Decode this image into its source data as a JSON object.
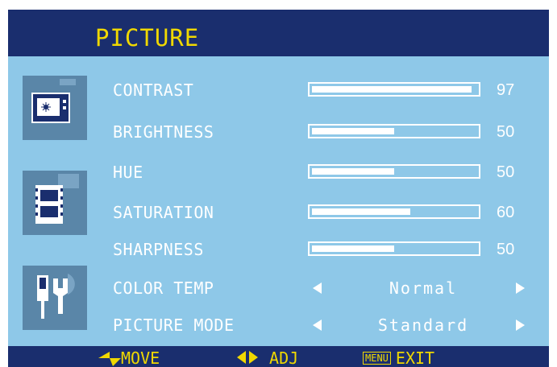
{
  "header": {
    "title": "PICTURE"
  },
  "icons": [
    "picture-icon",
    "film-icon",
    "tools-icon"
  ],
  "sliders": [
    {
      "name": "contrast",
      "label": "CONTRAST",
      "value": 97
    },
    {
      "name": "brightness",
      "label": "BRIGHTNESS",
      "value": 50
    },
    {
      "name": "hue",
      "label": "HUE",
      "value": 50
    },
    {
      "name": "saturation",
      "label": "SATURATION",
      "value": 60
    },
    {
      "name": "sharpness",
      "label": "SHARPNESS",
      "value": 50
    }
  ],
  "selectors": [
    {
      "name": "color-temp",
      "label": "COLOR TEMP",
      "value": "Normal"
    },
    {
      "name": "picture-mode",
      "label": "PICTURE MODE",
      "value": "Standard"
    }
  ],
  "footer": {
    "move": "MOVE",
    "adj": "ADJ",
    "menu_box": "MENU",
    "exit": "EXIT"
  },
  "colors": {
    "panel": "#8ec8e8",
    "header": "#1a2e6e",
    "accent": "#f0d800",
    "icon_bg": "#5a86a8"
  }
}
